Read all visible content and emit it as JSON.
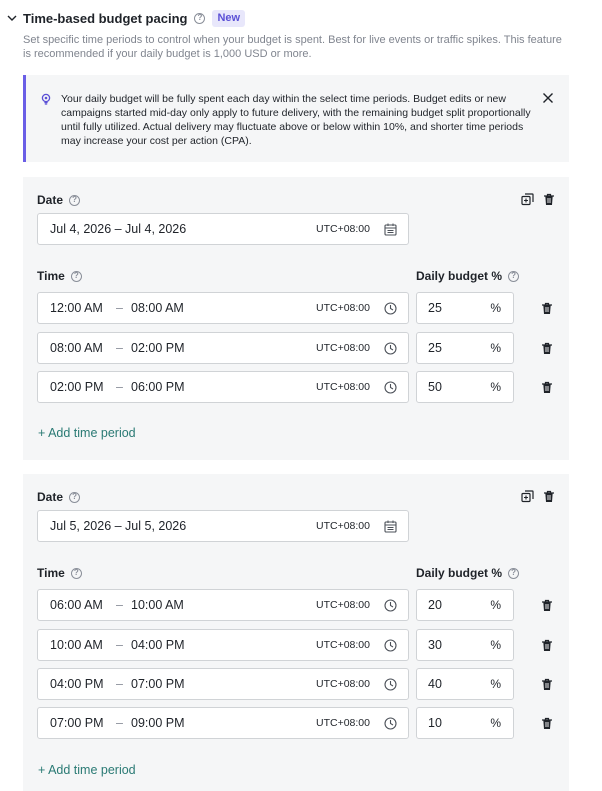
{
  "section": {
    "title": "Time-based budget pacing",
    "badge": "New",
    "description": "Set specific time periods to control when your budget is spent. Best for live events or traffic spikes. This feature is recommended if your daily budget is 1,000 USD or more."
  },
  "alert": {
    "text": "Your daily budget will be fully spent each day within the select time periods. Budget edits or new campaigns started mid-day only apply to future delivery, with the remaining budget split proportionally until fully utilized. Actual delivery may fluctuate above or below within 10%, and shorter time periods may increase your cost per action (CPA)."
  },
  "labels": {
    "date": "Date",
    "time": "Time",
    "daily_budget": "Daily budget %",
    "add_time_period": "+ Add time period",
    "percent_sign": "%"
  },
  "colors": {
    "accent": "#6a5ee6",
    "link": "#2a7a74",
    "card_bg": "#f5f6f7"
  },
  "cards": [
    {
      "date_range": "Jul 4, 2026 – Jul 4, 2026",
      "timezone": "UTC+08:00",
      "periods": [
        {
          "start": "12:00 AM",
          "end": "08:00 AM",
          "timezone": "UTC+08:00",
          "budget": "25"
        },
        {
          "start": "08:00 AM",
          "end": "02:00 PM",
          "timezone": "UTC+08:00",
          "budget": "25"
        },
        {
          "start": "02:00 PM",
          "end": "06:00 PM",
          "timezone": "UTC+08:00",
          "budget": "50"
        }
      ]
    },
    {
      "date_range": "Jul 5, 2026 – Jul 5, 2026",
      "timezone": "UTC+08:00",
      "periods": [
        {
          "start": "06:00 AM",
          "end": "10:00 AM",
          "timezone": "UTC+08:00",
          "budget": "20"
        },
        {
          "start": "10:00 AM",
          "end": "04:00 PM",
          "timezone": "UTC+08:00",
          "budget": "30"
        },
        {
          "start": "04:00 PM",
          "end": "07:00 PM",
          "timezone": "UTC+08:00",
          "budget": "40"
        },
        {
          "start": "07:00 PM",
          "end": "09:00 PM",
          "timezone": "UTC+08:00",
          "budget": "10"
        }
      ]
    }
  ]
}
